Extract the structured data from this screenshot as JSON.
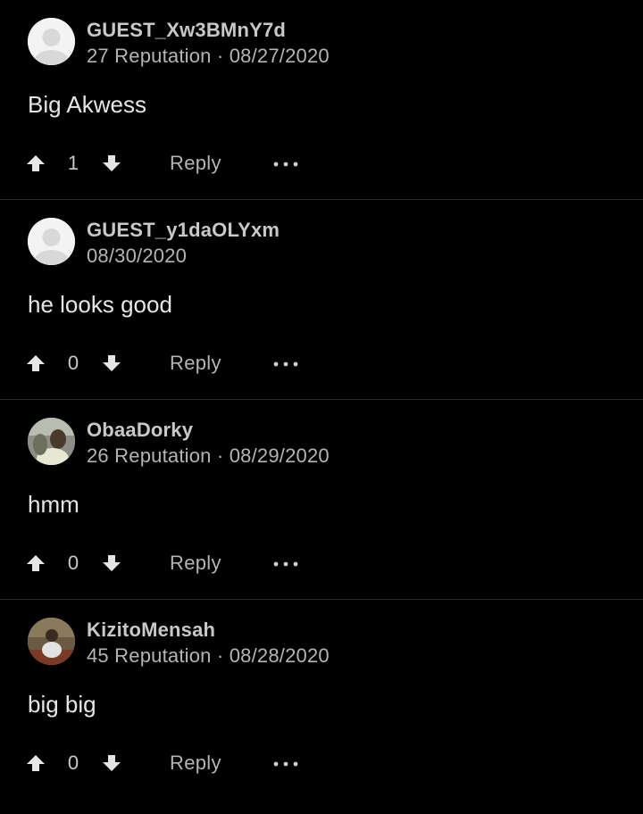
{
  "comments": [
    {
      "username": "GUEST_Xw3BMnY7d",
      "meta": "27 Reputation · 08/27/2020",
      "text": "Big Akwess",
      "votes": "1",
      "reply_label": "Reply",
      "avatar": "default-avatar"
    },
    {
      "username": "GUEST_y1daOLYxm",
      "meta": "08/30/2020",
      "text": "he looks good",
      "votes": "0",
      "reply_label": "Reply",
      "avatar": "default-avatar"
    },
    {
      "username": "ObaaDorky",
      "meta": "26 Reputation · 08/29/2020",
      "text": "hmm",
      "votes": "0",
      "reply_label": "Reply",
      "avatar": "photo-avatar"
    },
    {
      "username": "KizitoMensah",
      "meta": "45 Reputation · 08/28/2020",
      "text": "big big",
      "votes": "0",
      "reply_label": "Reply",
      "avatar": "photo-avatar"
    }
  ],
  "icons": {
    "upvote": "arrow-up-icon",
    "downvote": "arrow-down-icon",
    "more": "more-horizontal-icon"
  },
  "colors": {
    "background": "#000000",
    "text": "#e6e6e6",
    "muted": "#b4b4b4",
    "divider": "#2a2a2a"
  }
}
